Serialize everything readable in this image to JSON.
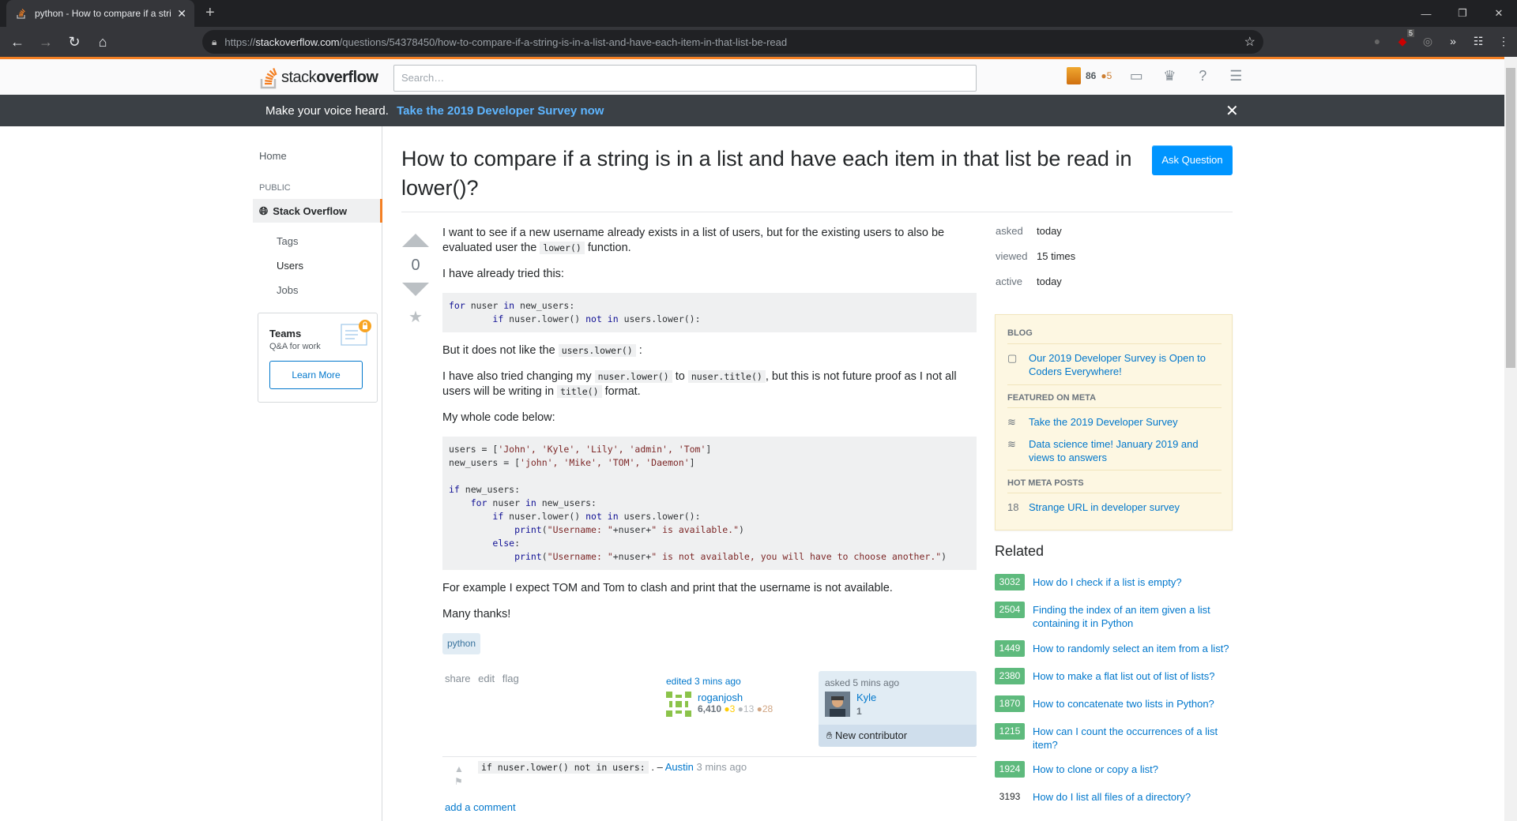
{
  "browser": {
    "tab_title": "python - How to compare if a stri",
    "url_prefix": "https://",
    "url_domain": "stackoverflow.com",
    "url_path": "/questions/54378450/how-to-compare-if-a-string-is-in-a-list-and-have-each-item-in-that-list-be-read",
    "ext_badge": "5"
  },
  "topbar": {
    "logo_light": "stack",
    "logo_bold": "overflow",
    "search_placeholder": "Search…",
    "reputation": "86",
    "bronze": "●5"
  },
  "banner": {
    "text": "Make your voice heard.",
    "link": "Take the 2019 Developer Survey now"
  },
  "nav": {
    "home": "Home",
    "public": "PUBLIC",
    "stackoverflow": "Stack Overflow",
    "tags": "Tags",
    "users": "Users",
    "jobs": "Jobs",
    "teams_title": "Teams",
    "teams_sub": "Q&A for work",
    "learn_more": "Learn More"
  },
  "question": {
    "title": "How to compare if a string is in a list and have each item in that list be read in lower()?",
    "ask_button": "Ask Question",
    "votes": "0",
    "p1a": "I want to see if a new username already exists in a list of users, but for the existing users to also be evaluated user the",
    "p1code": "lower()",
    "p1b": "function.",
    "p2": "I have already tried this:",
    "p3a": "But it does not like the",
    "p3code": "users.lower()",
    "p3b": ":",
    "p4a": "I have also tried changing my",
    "p4code1": "nuser.lower()",
    "p4b": "to",
    "p4code2": "nuser.title()",
    "p4c": ", but this is not future proof as I not all users will be writing in",
    "p4code3": "title()",
    "p4d": "format.",
    "p5": "My whole code below:",
    "p6": "For example I expect TOM and Tom to clash and print that the username is not available.",
    "p7": "Many thanks!",
    "tag": "python",
    "share": "share",
    "edit": "edit",
    "flag": "flag",
    "edited_label": "edited 3 mins ago",
    "editor_name": "roganjosh",
    "editor_rep": "6,410",
    "editor_gold": "●3",
    "editor_silver": "●13",
    "editor_bronze": "●28",
    "asked_label": "asked 5 mins ago",
    "asker_name": "Kyle",
    "asker_rep": "1",
    "new_contributor": "New contributor",
    "comment_code": "if nuser.lower() not in users:",
    "comment_sep": ". –",
    "comment_author": "Austin",
    "comment_time": "3 mins ago",
    "add_comment": "add a comment"
  },
  "stats": {
    "asked_k": "asked",
    "asked_v": "today",
    "viewed_k": "viewed",
    "viewed_v": "15 times",
    "active_k": "active",
    "active_v": "today"
  },
  "blog": {
    "h1": "BLOG",
    "i1": "Our 2019 Developer Survey is Open to Coders Everywhere!",
    "h2": "FEATURED ON META",
    "i2": "Take the 2019 Developer Survey",
    "i3": "Data science time! January 2019 and views to answers",
    "h3": "HOT META POSTS",
    "i4_num": "18",
    "i4": "Strange URL in developer survey"
  },
  "related": {
    "heading": "Related",
    "items": [
      {
        "score": "3032",
        "text": "How do I check if a list is empty?"
      },
      {
        "score": "2504",
        "text": "Finding the index of an item given a list containing it in Python"
      },
      {
        "score": "1449",
        "text": "How to randomly select an item from a list?"
      },
      {
        "score": "2380",
        "text": "How to make a flat list out of list of lists?"
      },
      {
        "score": "1870",
        "text": "How to concatenate two lists in Python?"
      },
      {
        "score": "1215",
        "text": "How can I count the occurrences of a list item?"
      },
      {
        "score": "1924",
        "text": "How to clone or copy a list?"
      },
      {
        "score": "3193",
        "text": "How do I list all files of a directory?"
      }
    ]
  },
  "code1": {
    "l1a": "for",
    "l1b": " nuser ",
    "l1c": "in",
    "l1d": " new_users:",
    "l2a": "        ",
    "l2b": "if",
    "l2c": " nuser.lower() ",
    "l2d": "not in",
    "l2e": " users.lower():"
  },
  "code2": {
    "l1": "users = [",
    "l1s": "'John', 'Kyle', 'Lily', 'admin', 'Tom'",
    "l1e": "]",
    "l2": "new_users = [",
    "l2s": "'john', 'Mike', 'TOM', 'Daemon'",
    "l2e": "]",
    "l4k": "if",
    "l4": " new_users:",
    "l5i": "    ",
    "l5k": "for",
    "l5a": " nuser ",
    "l5k2": "in",
    "l5b": " new_users:",
    "l6i": "        ",
    "l6k": "if",
    "l6a": " nuser.lower() ",
    "l6k2": "not in",
    "l6b": " users.lower():",
    "l7i": "            ",
    "l7f": "print",
    "l7a": "(",
    "l7s1": "\"Username: \"",
    "l7b": "+nuser+",
    "l7s2": "\" is available.\"",
    "l7c": ")",
    "l8i": "        ",
    "l8k": "else",
    "l8a": ":",
    "l9i": "            ",
    "l9f": "print",
    "l9a": "(",
    "l9s1": "\"Username: \"",
    "l9b": "+nuser+",
    "l9s2": "\" is not available, you will have to choose another.\"",
    "l9c": ")"
  }
}
